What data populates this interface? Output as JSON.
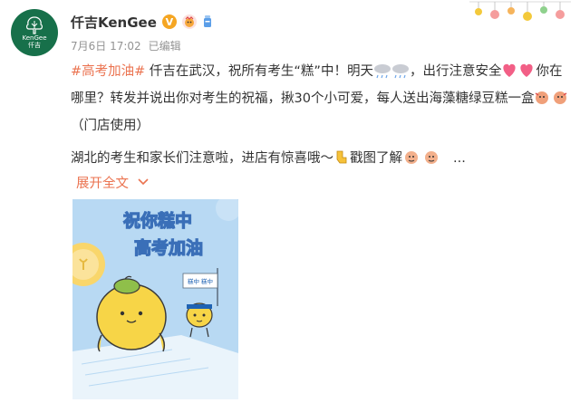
{
  "post": {
    "username": "仟吉KenGee",
    "verified_mark": "V",
    "date": "7月6日 17:02",
    "edited": "已编辑",
    "avatar_brand": "KenGee",
    "avatar_brand_cn": "仟吉",
    "topic": "#高考加油#",
    "text_1": " 仟吉在武汉，祝所有考生“糕”中！明天",
    "text_2": "，出行注意安全",
    "text_3": "你在哪里？转发并说出你对考生的祝福，揪30个小可爱，每人送出海藻糖绿豆糕一盒",
    "text_4": "（门店使用）",
    "text_5": "湖北的考生和家长们注意啦，进店有惊喜哦～",
    "text_6": "戳图了解",
    "ellipsis": "...",
    "expand_label": "展开全文"
  },
  "poster": {
    "line1": "祝你糕中",
    "line2": "高考加油",
    "flag_text": "糕中 糕中",
    "colors": {
      "bg": "#b8d9f3",
      "title": "#ffffff",
      "title_outline": "#3a6fb8",
      "accent": "#1f63b3",
      "bun": "#f7d547",
      "cake": "#f9d66b"
    }
  },
  "colors": {
    "link": "#eb7350",
    "meta": "#939393",
    "text": "#333333",
    "avatar_bg": "#17704a"
  },
  "icons": [
    "verified-v-icon",
    "member-badge-icon",
    "cup-badge-icon",
    "rain-cloud-icon",
    "heart-icon",
    "cheer-emoji-icon",
    "point-finger-icon",
    "chevron-down-icon"
  ]
}
